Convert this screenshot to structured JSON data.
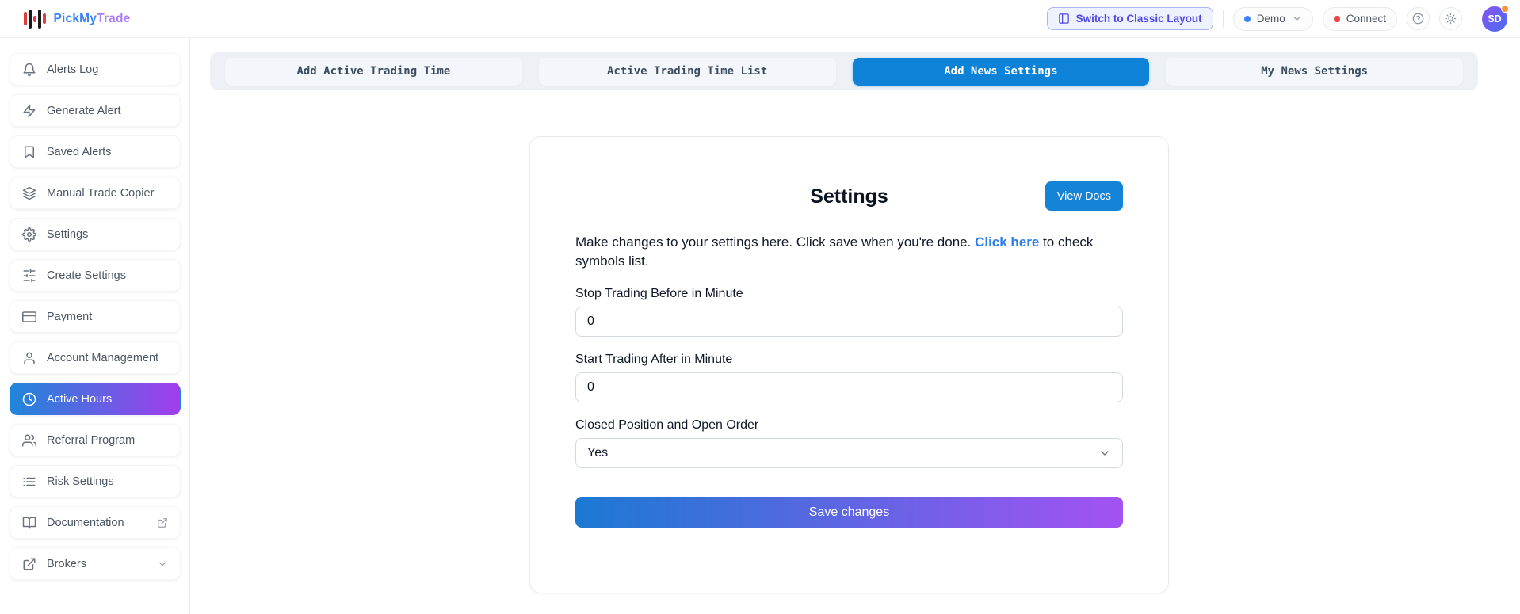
{
  "header": {
    "brand": {
      "name_primary": "PickMy",
      "name_secondary": "Trade"
    },
    "switch_layout_button": "Switch to Classic Layout",
    "demo_pill": "Demo",
    "connect_pill": "Connect",
    "avatar_initials": "SD"
  },
  "sidebar": {
    "items": [
      {
        "label": "Alerts Log",
        "icon": "bell-icon",
        "active": false
      },
      {
        "label": "Generate Alert",
        "icon": "zap-icon",
        "active": false
      },
      {
        "label": "Saved Alerts",
        "icon": "bookmark-icon",
        "active": false
      },
      {
        "label": "Manual Trade Copier",
        "icon": "layers-icon",
        "active": false
      },
      {
        "label": "Settings",
        "icon": "gear-icon",
        "active": false
      },
      {
        "label": "Create Settings",
        "icon": "sliders-icon",
        "active": false
      },
      {
        "label": "Payment",
        "icon": "credit-card-icon",
        "active": false
      },
      {
        "label": "Account Management",
        "icon": "user-icon",
        "active": false
      },
      {
        "label": "Active Hours",
        "icon": "clock-icon",
        "active": true
      },
      {
        "label": "Referral Program",
        "icon": "users-icon",
        "active": false
      },
      {
        "label": "Risk Settings",
        "icon": "list-icon",
        "active": false
      },
      {
        "label": "Documentation",
        "icon": "book-icon",
        "trailing": "external-link-icon",
        "active": false
      },
      {
        "label": "Brokers",
        "icon": "external-link-icon",
        "trailing": "chevron-down-icon",
        "active": false
      }
    ]
  },
  "tabs": [
    {
      "label": "Add Active Trading Time",
      "active": false
    },
    {
      "label": "Active Trading Time List",
      "active": false
    },
    {
      "label": "Add News Settings",
      "active": true
    },
    {
      "label": "My News Settings",
      "active": false
    }
  ],
  "settings_card": {
    "title": "Settings",
    "view_docs_button": "View Docs",
    "description_before_link": "Make changes to your settings here. Click save when you're done. ",
    "description_link": "Click here",
    "description_after_link": " to check symbols list.",
    "fields": [
      {
        "label": "Stop Trading Before in Minute",
        "value": "0",
        "type": "input"
      },
      {
        "label": "Start Trading After in Minute",
        "value": "0",
        "type": "input"
      },
      {
        "label": "Closed Position and Open Order",
        "value": "Yes",
        "type": "select"
      }
    ],
    "save_button": "Save changes"
  },
  "colors": {
    "brand_blue": "#3b82f6",
    "brand_purple": "#a97df5",
    "accent_blue": "#1583d6",
    "active_tab_bg": "#0e82d7",
    "active_item_gradient_start": "#1f86d9",
    "active_item_gradient_end": "#a23ded",
    "save_gradient_start": "#1b79d3",
    "save_gradient_end": "#a452f2",
    "link_blue": "#2f7fe8",
    "demo_dot": "#3b82f6",
    "connect_dot": "#ef4444",
    "notification_dot": "#fb923c",
    "switch_button_text": "#4f46e5"
  }
}
